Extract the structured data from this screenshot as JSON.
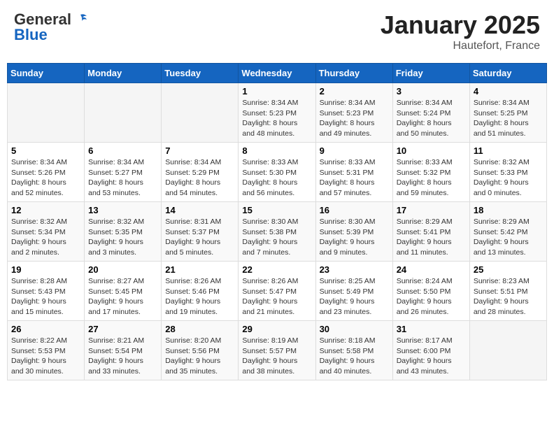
{
  "header": {
    "logo_general": "General",
    "logo_blue": "Blue",
    "month": "January 2025",
    "location": "Hautefort, France"
  },
  "weekdays": [
    "Sunday",
    "Monday",
    "Tuesday",
    "Wednesday",
    "Thursday",
    "Friday",
    "Saturday"
  ],
  "weeks": [
    [
      {
        "day": "",
        "info": ""
      },
      {
        "day": "",
        "info": ""
      },
      {
        "day": "",
        "info": ""
      },
      {
        "day": "1",
        "info": "Sunrise: 8:34 AM\nSunset: 5:23 PM\nDaylight: 8 hours\nand 48 minutes."
      },
      {
        "day": "2",
        "info": "Sunrise: 8:34 AM\nSunset: 5:23 PM\nDaylight: 8 hours\nand 49 minutes."
      },
      {
        "day": "3",
        "info": "Sunrise: 8:34 AM\nSunset: 5:24 PM\nDaylight: 8 hours\nand 50 minutes."
      },
      {
        "day": "4",
        "info": "Sunrise: 8:34 AM\nSunset: 5:25 PM\nDaylight: 8 hours\nand 51 minutes."
      }
    ],
    [
      {
        "day": "5",
        "info": "Sunrise: 8:34 AM\nSunset: 5:26 PM\nDaylight: 8 hours\nand 52 minutes."
      },
      {
        "day": "6",
        "info": "Sunrise: 8:34 AM\nSunset: 5:27 PM\nDaylight: 8 hours\nand 53 minutes."
      },
      {
        "day": "7",
        "info": "Sunrise: 8:34 AM\nSunset: 5:29 PM\nDaylight: 8 hours\nand 54 minutes."
      },
      {
        "day": "8",
        "info": "Sunrise: 8:33 AM\nSunset: 5:30 PM\nDaylight: 8 hours\nand 56 minutes."
      },
      {
        "day": "9",
        "info": "Sunrise: 8:33 AM\nSunset: 5:31 PM\nDaylight: 8 hours\nand 57 minutes."
      },
      {
        "day": "10",
        "info": "Sunrise: 8:33 AM\nSunset: 5:32 PM\nDaylight: 8 hours\nand 59 minutes."
      },
      {
        "day": "11",
        "info": "Sunrise: 8:32 AM\nSunset: 5:33 PM\nDaylight: 9 hours\nand 0 minutes."
      }
    ],
    [
      {
        "day": "12",
        "info": "Sunrise: 8:32 AM\nSunset: 5:34 PM\nDaylight: 9 hours\nand 2 minutes."
      },
      {
        "day": "13",
        "info": "Sunrise: 8:32 AM\nSunset: 5:35 PM\nDaylight: 9 hours\nand 3 minutes."
      },
      {
        "day": "14",
        "info": "Sunrise: 8:31 AM\nSunset: 5:37 PM\nDaylight: 9 hours\nand 5 minutes."
      },
      {
        "day": "15",
        "info": "Sunrise: 8:30 AM\nSunset: 5:38 PM\nDaylight: 9 hours\nand 7 minutes."
      },
      {
        "day": "16",
        "info": "Sunrise: 8:30 AM\nSunset: 5:39 PM\nDaylight: 9 hours\nand 9 minutes."
      },
      {
        "day": "17",
        "info": "Sunrise: 8:29 AM\nSunset: 5:41 PM\nDaylight: 9 hours\nand 11 minutes."
      },
      {
        "day": "18",
        "info": "Sunrise: 8:29 AM\nSunset: 5:42 PM\nDaylight: 9 hours\nand 13 minutes."
      }
    ],
    [
      {
        "day": "19",
        "info": "Sunrise: 8:28 AM\nSunset: 5:43 PM\nDaylight: 9 hours\nand 15 minutes."
      },
      {
        "day": "20",
        "info": "Sunrise: 8:27 AM\nSunset: 5:45 PM\nDaylight: 9 hours\nand 17 minutes."
      },
      {
        "day": "21",
        "info": "Sunrise: 8:26 AM\nSunset: 5:46 PM\nDaylight: 9 hours\nand 19 minutes."
      },
      {
        "day": "22",
        "info": "Sunrise: 8:26 AM\nSunset: 5:47 PM\nDaylight: 9 hours\nand 21 minutes."
      },
      {
        "day": "23",
        "info": "Sunrise: 8:25 AM\nSunset: 5:49 PM\nDaylight: 9 hours\nand 23 minutes."
      },
      {
        "day": "24",
        "info": "Sunrise: 8:24 AM\nSunset: 5:50 PM\nDaylight: 9 hours\nand 26 minutes."
      },
      {
        "day": "25",
        "info": "Sunrise: 8:23 AM\nSunset: 5:51 PM\nDaylight: 9 hours\nand 28 minutes."
      }
    ],
    [
      {
        "day": "26",
        "info": "Sunrise: 8:22 AM\nSunset: 5:53 PM\nDaylight: 9 hours\nand 30 minutes."
      },
      {
        "day": "27",
        "info": "Sunrise: 8:21 AM\nSunset: 5:54 PM\nDaylight: 9 hours\nand 33 minutes."
      },
      {
        "day": "28",
        "info": "Sunrise: 8:20 AM\nSunset: 5:56 PM\nDaylight: 9 hours\nand 35 minutes."
      },
      {
        "day": "29",
        "info": "Sunrise: 8:19 AM\nSunset: 5:57 PM\nDaylight: 9 hours\nand 38 minutes."
      },
      {
        "day": "30",
        "info": "Sunrise: 8:18 AM\nSunset: 5:58 PM\nDaylight: 9 hours\nand 40 minutes."
      },
      {
        "day": "31",
        "info": "Sunrise: 8:17 AM\nSunset: 6:00 PM\nDaylight: 9 hours\nand 43 minutes."
      },
      {
        "day": "",
        "info": ""
      }
    ]
  ]
}
